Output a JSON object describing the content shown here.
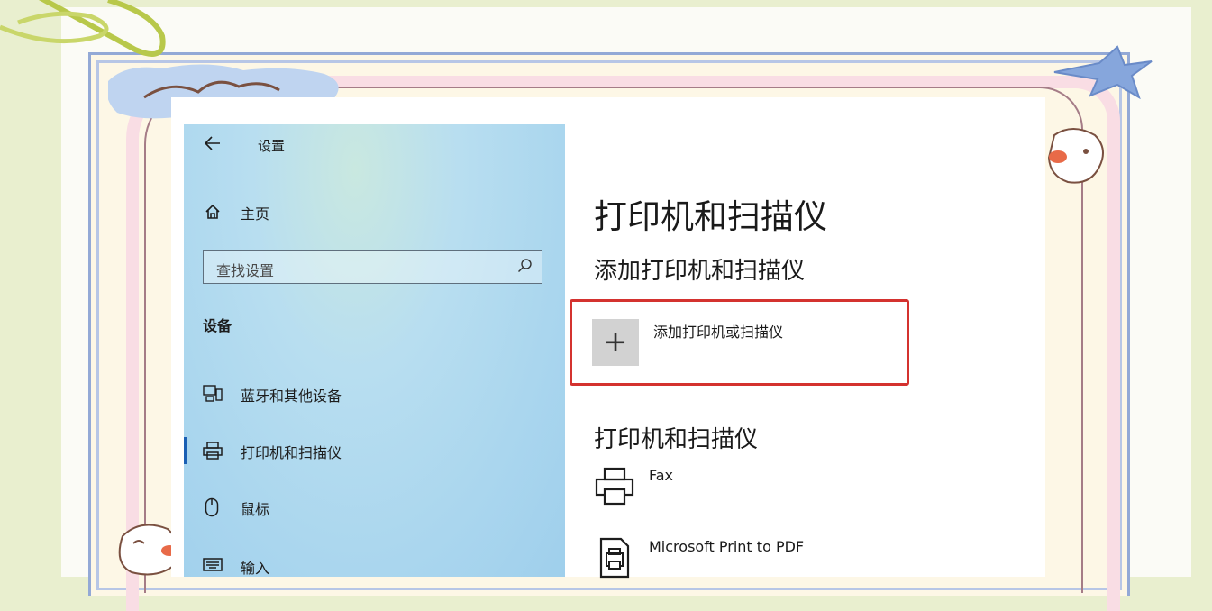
{
  "window": {
    "back_icon": "back-arrow-icon",
    "title": "设置"
  },
  "sidebar": {
    "home": {
      "icon": "home-icon",
      "label": "主页"
    },
    "search": {
      "placeholder": "查找设置",
      "icon": "search-icon"
    },
    "section_title": "设备",
    "items": [
      {
        "icon": "bluetooth-devices-icon",
        "label": "蓝牙和其他设备",
        "selected": false
      },
      {
        "icon": "printer-icon",
        "label": "打印机和扫描仪",
        "selected": true
      },
      {
        "icon": "mouse-icon",
        "label": "鼠标",
        "selected": false
      },
      {
        "icon": "keyboard-icon",
        "label": "输入",
        "selected": false
      }
    ]
  },
  "main": {
    "page_title": "打印机和扫描仪",
    "add_section_title": "添加打印机和扫描仪",
    "add_button": {
      "icon": "plus-icon",
      "label": "添加打印机或扫描仪"
    },
    "list_section_title": "打印机和扫描仪",
    "devices": [
      {
        "icon": "printer-icon",
        "name": "Fax"
      },
      {
        "icon": "pdf-printer-icon",
        "name": "Microsoft Print to PDF"
      }
    ]
  },
  "colors": {
    "highlight_border": "#d4322f",
    "accent": "#1a5fb4",
    "background": "#e9efcf"
  }
}
